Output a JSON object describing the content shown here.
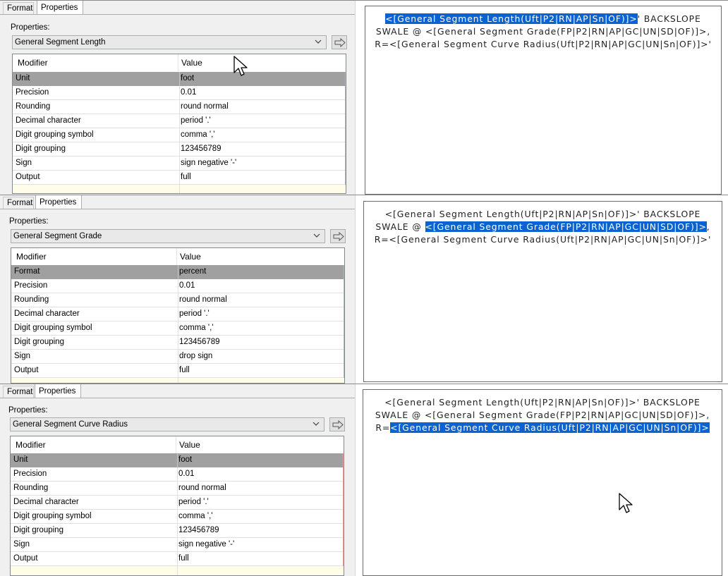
{
  "panels": [
    {
      "tabs": {
        "format": "Format",
        "properties": "Properties"
      },
      "properties_label": "Properties:",
      "combo_value": "General Segment Length",
      "grid": {
        "header": {
          "modifier": "Modifier",
          "value": "Value"
        },
        "rows": [
          {
            "modifier": "Unit",
            "value": "foot"
          },
          {
            "modifier": "Precision",
            "value": "0.01"
          },
          {
            "modifier": "Rounding",
            "value": "round normal"
          },
          {
            "modifier": "Decimal character",
            "value": "period '.'"
          },
          {
            "modifier": "Digit grouping symbol",
            "value": "comma ','"
          },
          {
            "modifier": "Digit grouping",
            "value": "123456789"
          },
          {
            "modifier": "Sign",
            "value": "sign negative '-'"
          },
          {
            "modifier": "Output",
            "value": "full"
          }
        ]
      },
      "preview": {
        "line1_pre": "",
        "line1_hl": "<[General Segment Length(Uft|P2|RN|AP|Sn|OF)]>",
        "line1_post": "' BACKSLOPE",
        "line2_pre": "SWALE @ <[General Segment Grade(FP|P2|RN|AP|GC|UN|SD|OF)]>,",
        "line2_hl": "",
        "line2_post": "",
        "line3_pre": "R=<[General Segment Curve Radius(Uft|P2|RN|AP|GC|UN|Sn|OF)]>'",
        "line3_hl": "",
        "line3_post": ""
      }
    },
    {
      "tabs": {
        "format": "Format",
        "properties": "Properties"
      },
      "properties_label": "Properties:",
      "combo_value": "General Segment Grade",
      "grid": {
        "header": {
          "modifier": "Modifier",
          "value": "Value"
        },
        "rows": [
          {
            "modifier": "Format",
            "value": "percent"
          },
          {
            "modifier": "Precision",
            "value": "0.01"
          },
          {
            "modifier": "Rounding",
            "value": "round normal"
          },
          {
            "modifier": "Decimal character",
            "value": "period '.'"
          },
          {
            "modifier": "Digit grouping symbol",
            "value": "comma ','"
          },
          {
            "modifier": "Digit grouping",
            "value": "123456789"
          },
          {
            "modifier": "Sign",
            "value": "drop sign"
          },
          {
            "modifier": "Output",
            "value": "full"
          }
        ]
      },
      "preview": {
        "line1_pre": "<[General Segment Length(Uft|P2|RN|AP|Sn|OF)]>' BACKSLOPE",
        "line1_hl": "",
        "line1_post": "",
        "line2_pre": "SWALE @ ",
        "line2_hl": "<[General Segment Grade(FP|P2|RN|AP|GC|UN|SD|OF)]>",
        "line2_post": ",",
        "line3_pre": "R=<[General Segment Curve Radius(Uft|P2|RN|AP|GC|UN|Sn|OF)]>'",
        "line3_hl": "",
        "line3_post": ""
      }
    },
    {
      "tabs": {
        "format": "Format",
        "properties": "Properties"
      },
      "properties_label": "Properties:",
      "combo_value": "General Segment Curve Radius",
      "grid": {
        "header": {
          "modifier": "Modifier",
          "value": "Value"
        },
        "rows": [
          {
            "modifier": "Unit",
            "value": "foot"
          },
          {
            "modifier": "Precision",
            "value": "0.01"
          },
          {
            "modifier": "Rounding",
            "value": "round normal"
          },
          {
            "modifier": "Decimal character",
            "value": "period '.'"
          },
          {
            "modifier": "Digit grouping symbol",
            "value": "comma ','"
          },
          {
            "modifier": "Digit grouping",
            "value": "123456789"
          },
          {
            "modifier": "Sign",
            "value": "sign negative '-'"
          },
          {
            "modifier": "Output",
            "value": "full"
          }
        ]
      },
      "preview": {
        "line1_pre": "<[General Segment Length(Uft|P2|RN|AP|Sn|OF)]>' BACKSLOPE",
        "line1_hl": "",
        "line1_post": "",
        "line2_pre": "SWALE @ <[General Segment Grade(FP|P2|RN|AP|GC|UN|SD|OF)]>,",
        "line2_hl": "",
        "line2_post": "",
        "line3_pre": "R=",
        "line3_hl": "<[General Segment Curve Radius(Uft|P2|RN|AP|GC|UN|Sn|OF)]>",
        "line3_post": ""
      }
    }
  ],
  "colors": {
    "selection": "#0a63d1",
    "selected_row": "#a0a0a0",
    "pane": "#f0f0f0"
  }
}
